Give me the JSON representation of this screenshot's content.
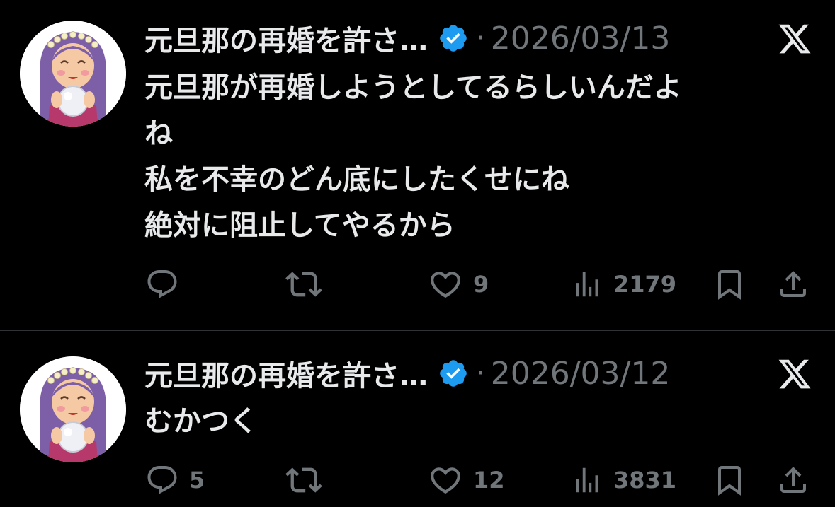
{
  "colors": {
    "background": "#000000",
    "text": "#e7e9ea",
    "muted": "#71767b",
    "verified": "#1d9bf0",
    "divider": "#2f3336"
  },
  "tweets": [
    {
      "author": "元旦那の再婚を許さ…",
      "separator": "·",
      "date": "2026/03/13",
      "lines": [
        "元旦那が再婚しようとしてるらしいんだよ",
        "ね",
        "私を不幸のどん底にしたくせにね",
        "絶対に阻止してやるから"
      ],
      "replies": "",
      "retweets": "",
      "likes": "9",
      "views": "2179"
    },
    {
      "author": "元旦那の再婚を許さ…",
      "separator": "·",
      "date": "2026/03/12",
      "lines": [
        "むかつく"
      ],
      "replies": "5",
      "retweets": "",
      "likes": "12",
      "views": "3831"
    }
  ],
  "icons": [
    "avatar",
    "verified-badge-icon",
    "x-logo-icon",
    "reply-icon",
    "retweet-icon",
    "like-icon",
    "views-icon",
    "bookmark-icon",
    "share-icon"
  ]
}
